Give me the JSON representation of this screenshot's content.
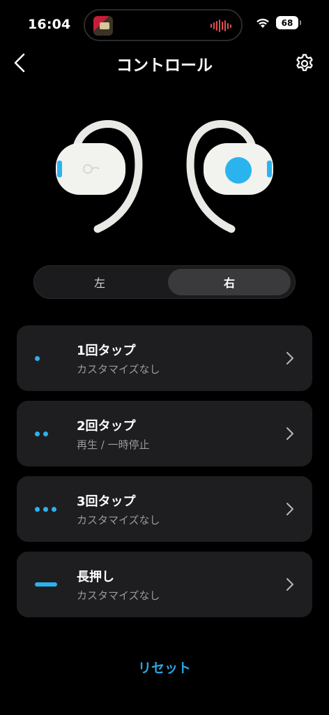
{
  "status_bar": {
    "time": "16:04",
    "battery": "68",
    "icons": [
      "album-art-icon",
      "audio-waveform-icon",
      "wifi-icon",
      "battery-icon"
    ]
  },
  "header": {
    "title": "コントロール",
    "back_icon": "chevron-left-icon",
    "settings_icon": "gear-icon"
  },
  "earbuds": {
    "left_icon": "left-earbud-icon",
    "right_icon": "right-earbud-icon",
    "selected": "right",
    "highlight_color": "#2bb3ee"
  },
  "side_selector": {
    "left_label": "左",
    "right_label": "右",
    "selected": "right"
  },
  "controls": [
    {
      "title": "1回タップ",
      "action": "カスタマイズなし",
      "icon": "single-dot-icon"
    },
    {
      "title": "2回タップ",
      "action": "再生 / 一時停止",
      "icon": "double-dot-icon"
    },
    {
      "title": "3回タップ",
      "action": "カスタマイズなし",
      "icon": "triple-dot-icon"
    },
    {
      "title": "長押し",
      "action": "カスタマイズなし",
      "icon": "long-press-icon"
    }
  ],
  "reset_label": "リセット",
  "colors": {
    "background": "#000000",
    "card": "#1e1e20",
    "accent": "#2bb3ee",
    "secondary_text": "#9a9a9e"
  }
}
